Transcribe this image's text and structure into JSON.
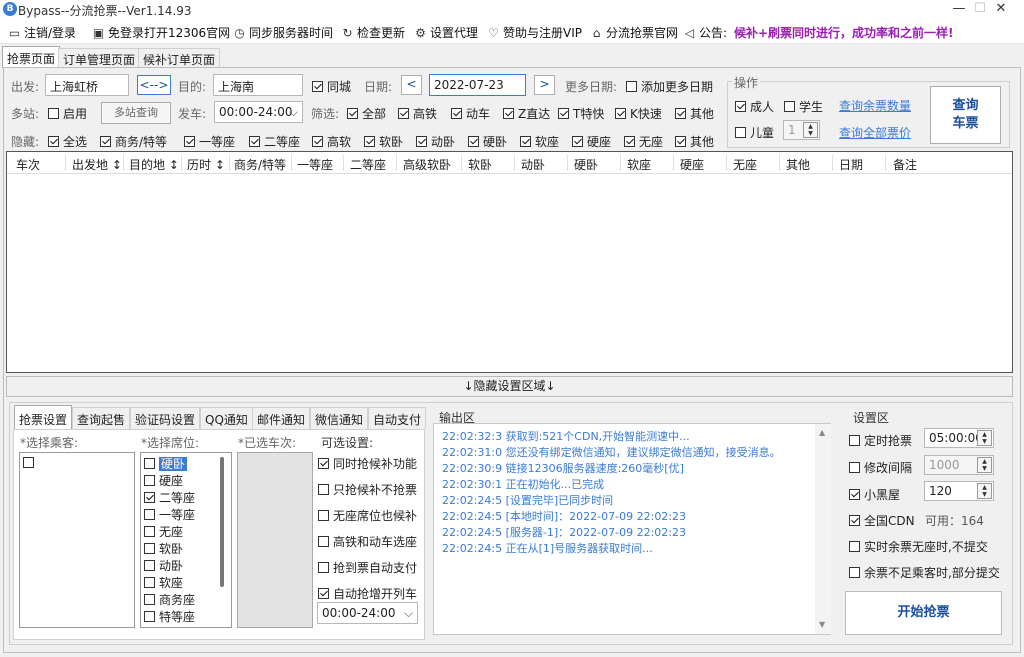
{
  "window": {
    "title": "Bypass--分流抢票--Ver1.14.93",
    "controls": {
      "minimize": "—",
      "maximize": "☐",
      "close": "✕"
    }
  },
  "menu": [
    {
      "icon": "monitor-icon",
      "glyph": "▭",
      "label": "注销/登录"
    },
    {
      "icon": "browser-icon",
      "glyph": "▣",
      "label": "免登录打开12306官网"
    },
    {
      "icon": "clock-icon",
      "glyph": "◷",
      "label": "同步服务器时间"
    },
    {
      "icon": "refresh-icon",
      "glyph": "↻",
      "label": "检查更新"
    },
    {
      "icon": "gear-icon",
      "glyph": "⚙",
      "label": "设置代理"
    },
    {
      "icon": "heart-icon",
      "glyph": "♡",
      "label": "赞助与注册VIP"
    },
    {
      "icon": "home-icon",
      "glyph": "⌂",
      "label": "分流抢票官网"
    },
    {
      "icon": "speaker-icon",
      "glyph": "🔈",
      "label": "公告:"
    }
  ],
  "notice": "候补+刷票同时进行，成功率和之前一样!",
  "tabs": [
    "抢票页面",
    "订单管理页面",
    "候补订单页面"
  ],
  "query": {
    "from_label": "出发:",
    "from_value": "上海虹桥",
    "swap_label": "<-->",
    "to_label": "目的:",
    "to_value": "上海南",
    "same_city_label": "同城",
    "date_label": "日期:",
    "date_prev": "<",
    "date_value": "2022-07-23",
    "date_next": ">",
    "more_dates_label": "更多日期:",
    "add_more_dates": "添加更多日期",
    "multi_station_label": "多站:",
    "enable_label": "启用",
    "multi_query_btn": "多站查询",
    "depart_label": "发车:",
    "depart_value": "00:00-24:00",
    "filter_label": "筛选:",
    "filters": [
      "全部",
      "高铁",
      "动车",
      "Z直达",
      "T特快",
      "K快速",
      "其他"
    ],
    "hide_label": "隐藏:",
    "hide_items": [
      "全选",
      "商务/特等",
      "一等座",
      "二等座",
      "高软",
      "软卧",
      "动卧",
      "硬卧",
      "软座",
      "硬座",
      "无座",
      "其他"
    ]
  },
  "ops": {
    "title": "操作",
    "adult": "成人",
    "student": "学生",
    "child": "儿童",
    "child_count": "1",
    "link1": "查询余票数量",
    "link2": "查询全部票价",
    "query_btn_line1": "查询",
    "query_btn_line2": "车票"
  },
  "grid_columns": [
    "车次",
    "出发地 ↕",
    "目的地 ↕",
    "历时 ↕",
    "商务/特等",
    "一等座",
    "二等座",
    "高级软卧",
    "软卧",
    "动卧",
    "硬卧",
    "软座",
    "硬座",
    "无座",
    "其他",
    "日期",
    "备注"
  ],
  "hide_settings": "↓隐藏设置区域↓",
  "subtabs": [
    "抢票设置",
    "查询起售",
    "验证码设置",
    "QQ通知",
    "邮件通知",
    "微信通知",
    "自动支付"
  ],
  "settings": {
    "passenger_label": "*选择乘客:",
    "seat_label": "*选择席位:",
    "train_label": "*已选车次:",
    "optional_label": "可选设置:",
    "seats": [
      {
        "name": "硬卧",
        "checked": false,
        "highlight": true
      },
      {
        "name": "硬座",
        "checked": false
      },
      {
        "name": "二等座",
        "checked": true
      },
      {
        "name": "一等座",
        "checked": false
      },
      {
        "name": "无座",
        "checked": false
      },
      {
        "name": "软卧",
        "checked": false
      },
      {
        "name": "动卧",
        "checked": false
      },
      {
        "name": "软座",
        "checked": false
      },
      {
        "name": "商务座",
        "checked": false
      },
      {
        "name": "特等座",
        "checked": false
      }
    ],
    "options": [
      {
        "label": "同时抢候补功能",
        "checked": true
      },
      {
        "label": "只抢候补不抢票",
        "checked": false
      },
      {
        "label": "无座席位也候补",
        "checked": false
      },
      {
        "label": "高铁和动车选座",
        "checked": false
      },
      {
        "label": "抢到票自动支付",
        "checked": false
      },
      {
        "label": "自动抢增开列车",
        "checked": true
      }
    ],
    "time_range": "00:00-24:00"
  },
  "output": {
    "title": "输出区",
    "lines": [
      "22:02:32:3  获取到:521个CDN,开始智能测速中...",
      "22:02:31:0  您还没有绑定微信通知，建议绑定微信通知，接受消息。",
      "22:02:30:9  链接12306服务器速度:260毫秒[优]",
      "22:02:30:1  正在初始化...已完成",
      "22:02:24:5  [设置完毕]已同步时间",
      "22:02:24:5  [本地时间]：2022-07-09 22:02:23",
      "22:02:24:5  [服务器-1]：2022-07-09 22:02:23",
      "22:02:24:5  正在从[1]号服务器获取时间..."
    ]
  },
  "config": {
    "title": "设置区",
    "timed_label": "定时抢票",
    "timed_value": "05:00:00",
    "interval_label": "修改间隔",
    "interval_value": "1000",
    "blackroom_label": "小黑屋",
    "blackroom_value": "120",
    "cdn_label": "全国CDN",
    "cdn_available": "可用：164",
    "realtime_label": "实时余票无座时,不提交",
    "partial_label": "余票不足乘客时,部分提交",
    "start_btn": "开始抢票"
  }
}
